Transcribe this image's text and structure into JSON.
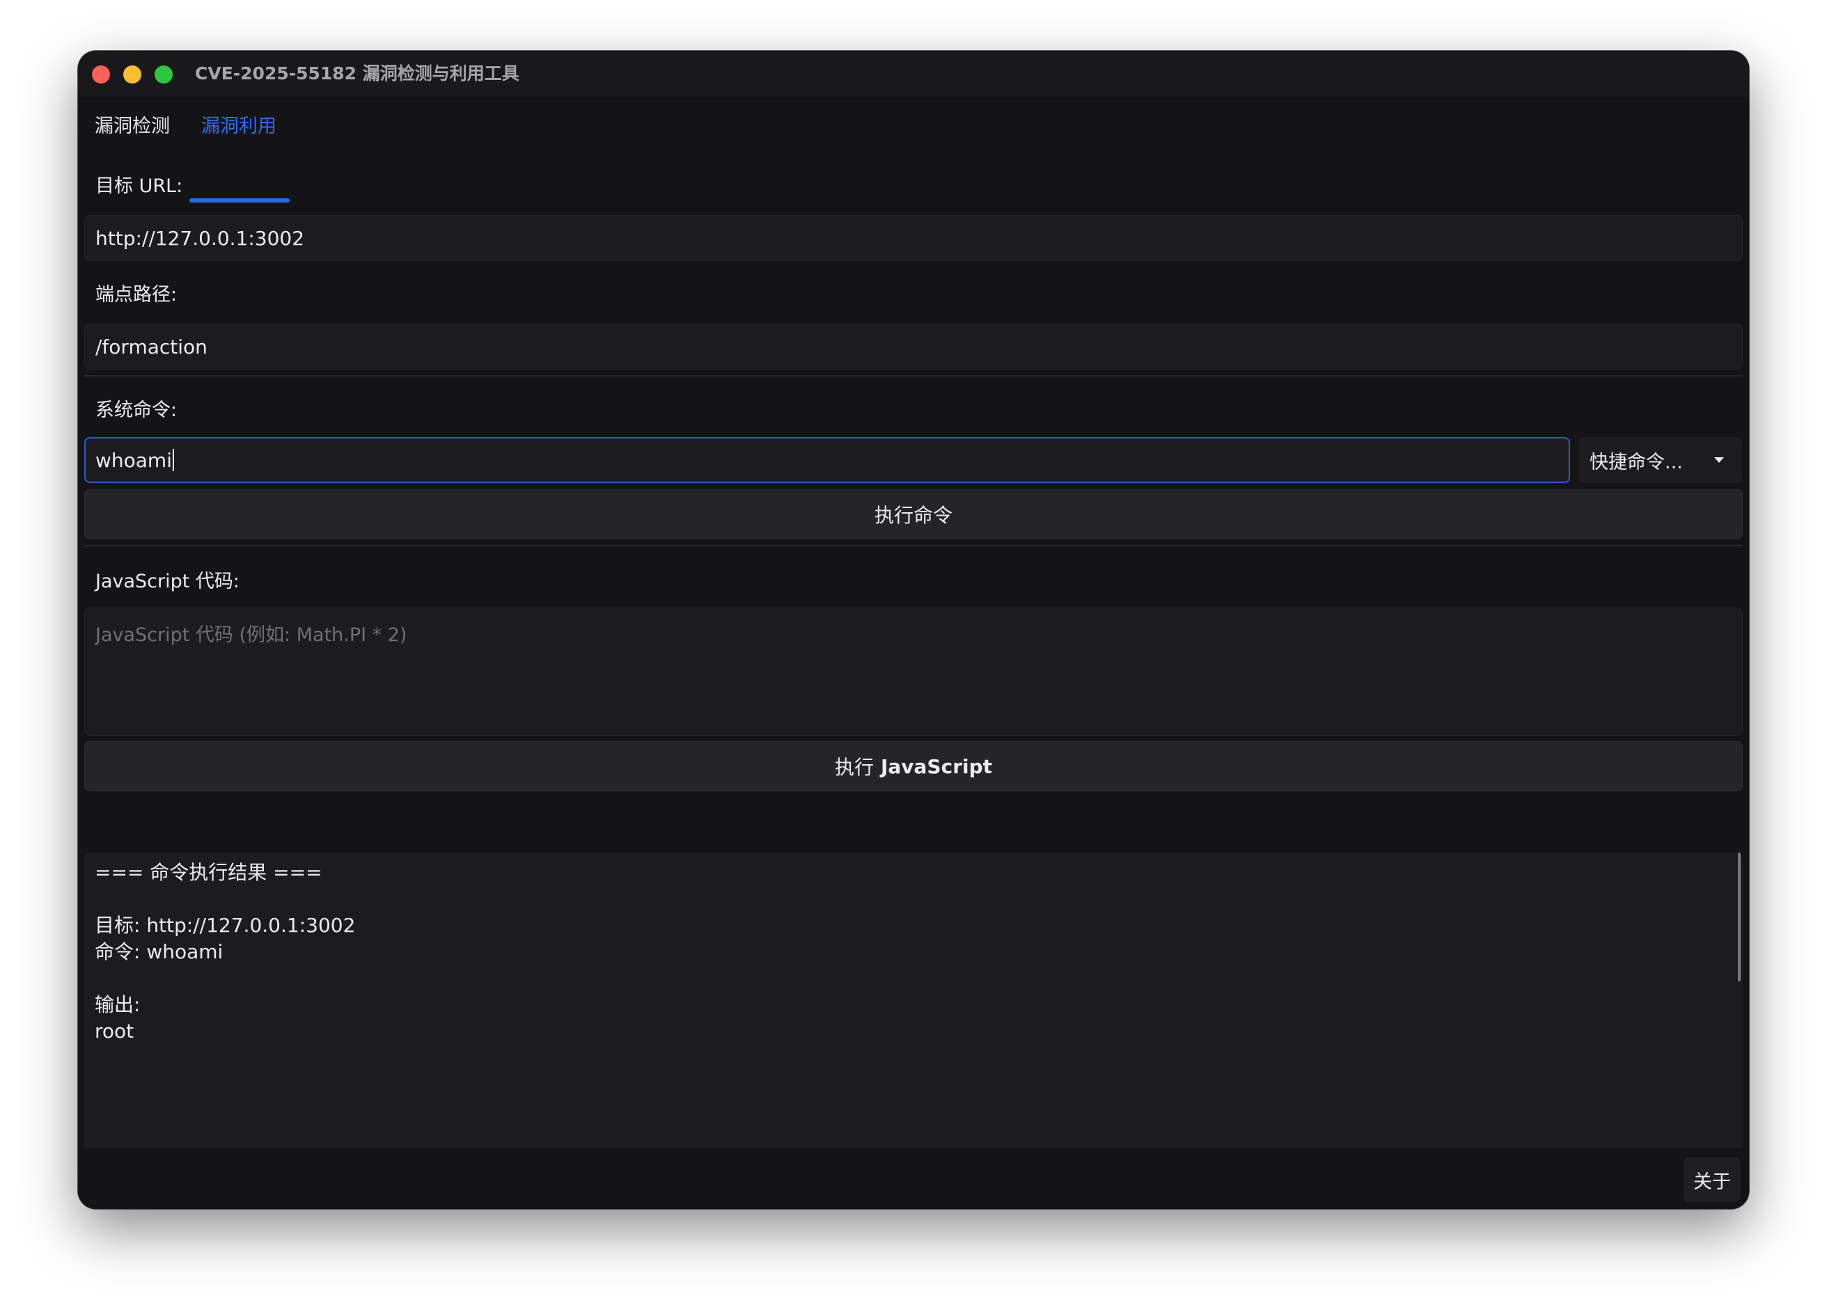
{
  "window": {
    "title": "CVE-2025-55182 漏洞检测与利用工具"
  },
  "tabs": [
    {
      "label": "漏洞检测",
      "active": false
    },
    {
      "label": "漏洞利用",
      "active": true
    }
  ],
  "form": {
    "target_url_label": "目标 URL:",
    "target_url_value": "http://127.0.0.1:3002",
    "endpoint_label": "端点路径:",
    "endpoint_value": "/formaction",
    "command_label": "系统命令:",
    "command_value": "whoami",
    "quick_commands_label": "快捷命令...",
    "execute_command_label": "执行命令",
    "js_label": "JavaScript 代码:",
    "js_placeholder": "JavaScript 代码 (例如: Math.PI * 2)",
    "execute_js_prefix": "执行",
    "execute_js_bold": "JavaScript"
  },
  "output": {
    "lines": [
      "=== 命令执行结果 ===",
      "",
      "目标: http://127.0.0.1:3002",
      "命令: whoami",
      "",
      "输出:",
      "root"
    ]
  },
  "footer": {
    "about_label": "关于"
  },
  "colors": {
    "accent": "#1f6cf5",
    "window_bg": "#141416",
    "field_bg": "#1c1c1f"
  }
}
